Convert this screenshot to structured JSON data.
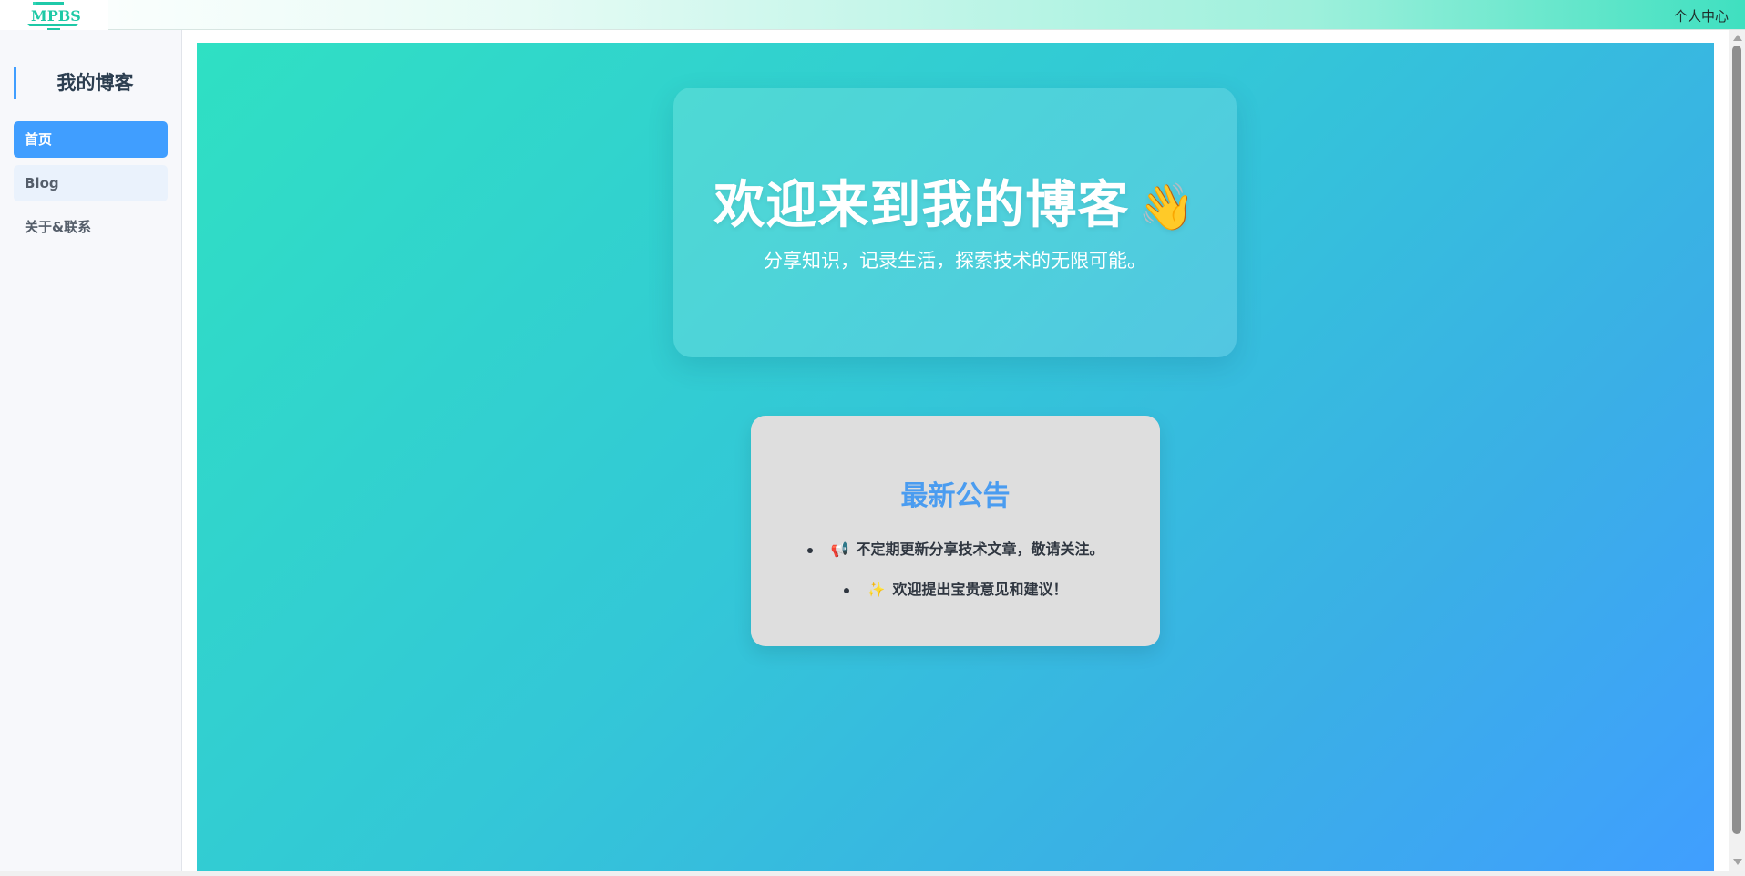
{
  "header": {
    "logo_icon": "mpbs-logo",
    "user_center_label": "个人中心"
  },
  "sidebar": {
    "brand_title": "我的博客",
    "items": [
      {
        "label": "首页",
        "state": "active"
      },
      {
        "label": "Blog",
        "state": "hover"
      },
      {
        "label": "关于&联系",
        "state": "normal"
      }
    ]
  },
  "hero": {
    "title": "欢迎来到我的博客",
    "title_emoji": "👋",
    "subtitle": "分享知识，记录生活，探索技术的无限可能。"
  },
  "notice": {
    "title": "最新公告",
    "items": [
      {
        "emoji": "📢",
        "text": "不定期更新分享技术文章，敬请关注。"
      },
      {
        "emoji": "✨",
        "text": "欢迎提出宝贵意见和建议！"
      }
    ]
  },
  "colors": {
    "accent": "#409eff",
    "gradient_start": "#2fe0c3",
    "gradient_end": "#409eff",
    "notice_title": "#4a9cf0"
  }
}
